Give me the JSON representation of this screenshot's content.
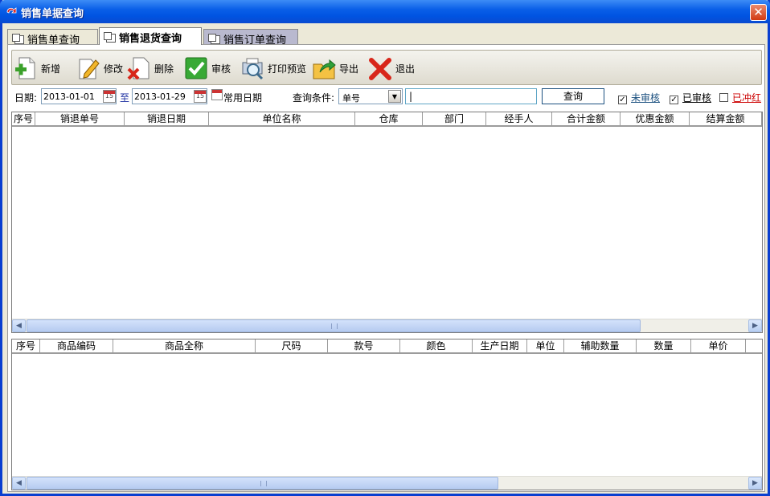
{
  "window": {
    "title": "销售单据查询",
    "close_glyph": "✕"
  },
  "tabs": [
    {
      "label": "销售单查询",
      "active": false
    },
    {
      "label": "销售退货查询",
      "active": true
    },
    {
      "label": "销售订单查询",
      "active": false
    }
  ],
  "toolbar": {
    "add": "新增",
    "edit": "修改",
    "delete": "删除",
    "audit": "审核",
    "print_preview": "打印预览",
    "export": "导出",
    "exit": "退出"
  },
  "filter": {
    "date_label": "日期:",
    "date_from": "2013-01-01",
    "to_label": "至",
    "date_to": "2013-01-29",
    "common_dates": "常用日期",
    "query_condition_label": "查询条件:",
    "query_condition_value": "单号",
    "query_text": "|",
    "query_button": "查询",
    "unaudited": {
      "label": "未审核",
      "checked": true
    },
    "audited": {
      "label": "已审核",
      "checked": true
    },
    "reversed": {
      "label": "已冲红",
      "checked": false
    },
    "calendar_glyph": "15",
    "checkmark": "✓",
    "combo_arrow": "▼"
  },
  "top_table": {
    "columns": [
      "序号",
      "销退单号",
      "销退日期",
      "单位名称",
      "仓库",
      "部门",
      "经手人",
      "合计金额",
      "优惠金额",
      "结算金额"
    ]
  },
  "bottom_table": {
    "columns": [
      "序号",
      "商品编码",
      "商品全称",
      "尺码",
      "款号",
      "颜色",
      "生产日期",
      "单位",
      "辅助数量",
      "数量",
      "单价"
    ]
  },
  "scroll": {
    "left": "◀",
    "right": "▶"
  },
  "colors": {
    "title_bar": "#0a5fe8",
    "accent_link": "#1c5180",
    "reversed_text": "#cc0000"
  }
}
